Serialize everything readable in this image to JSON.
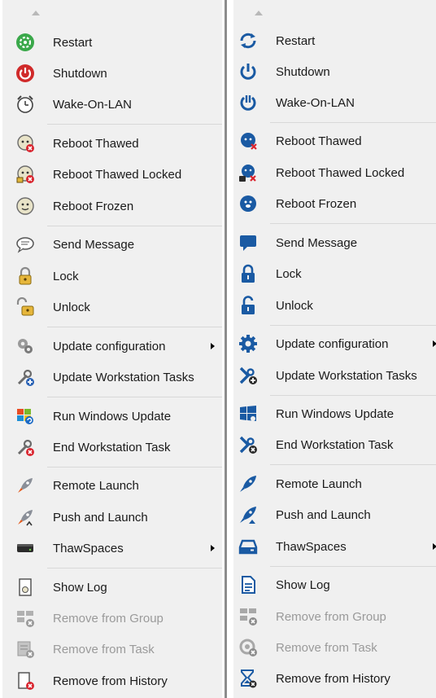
{
  "left_menu": {
    "items": [
      {
        "label": "Restart",
        "icon": "restart-icon"
      },
      {
        "label": "Shutdown",
        "icon": "power-icon"
      },
      {
        "label": "Wake-On-LAN",
        "icon": "alarm-clock-icon"
      },
      {
        "label": "Reboot Thawed",
        "icon": "reboot-thawed-icon"
      },
      {
        "label": "Reboot Thawed Locked",
        "icon": "reboot-thawed-locked-icon"
      },
      {
        "label": "Reboot Frozen",
        "icon": "reboot-frozen-icon"
      },
      {
        "label": "Send Message",
        "icon": "message-icon"
      },
      {
        "label": "Lock",
        "icon": "lock-icon"
      },
      {
        "label": "Unlock",
        "icon": "unlock-icon"
      },
      {
        "label": "Update configuration",
        "icon": "gears-icon",
        "submenu": true
      },
      {
        "label": "Update Workstation Tasks",
        "icon": "tools-add-icon"
      },
      {
        "label": "Run Windows Update",
        "icon": "windows-update-icon"
      },
      {
        "label": "End Workstation Task",
        "icon": "tools-remove-icon"
      },
      {
        "label": "Remote Launch",
        "icon": "rocket-icon"
      },
      {
        "label": "Push and Launch",
        "icon": "rocket-push-icon"
      },
      {
        "label": "ThawSpaces",
        "icon": "drive-icon",
        "submenu": true
      },
      {
        "label": "Show Log",
        "icon": "log-icon"
      },
      {
        "label": "Remove from Group",
        "icon": "remove-group-icon",
        "disabled": true
      },
      {
        "label": "Remove from Task",
        "icon": "remove-task-icon",
        "disabled": true
      },
      {
        "label": "Remove from History",
        "icon": "remove-history-icon"
      }
    ]
  },
  "right_menu": {
    "items": [
      {
        "label": "Restart",
        "icon": "restart-icon"
      },
      {
        "label": "Shutdown",
        "icon": "power-icon"
      },
      {
        "label": "Wake-On-LAN",
        "icon": "wake-power-icon"
      },
      {
        "label": "Reboot Thawed",
        "icon": "reboot-thawed-icon"
      },
      {
        "label": "Reboot Thawed Locked",
        "icon": "reboot-thawed-locked-icon"
      },
      {
        "label": "Reboot Frozen",
        "icon": "reboot-frozen-icon"
      },
      {
        "label": "Send Message",
        "icon": "message-icon"
      },
      {
        "label": "Lock",
        "icon": "lock-icon"
      },
      {
        "label": "Unlock",
        "icon": "unlock-icon"
      },
      {
        "label": "Update configuration",
        "icon": "gear-icon",
        "submenu": true
      },
      {
        "label": "Update Workstation Tasks",
        "icon": "tools-add-icon"
      },
      {
        "label": "Run Windows Update",
        "icon": "windows-update-icon"
      },
      {
        "label": "End Workstation Task",
        "icon": "tools-remove-icon"
      },
      {
        "label": "Remote Launch",
        "icon": "rocket-icon"
      },
      {
        "label": "Push and Launch",
        "icon": "rocket-push-icon"
      },
      {
        "label": "ThawSpaces",
        "icon": "drive-icon",
        "submenu": true
      },
      {
        "label": "Show Log",
        "icon": "log-icon"
      },
      {
        "label": "Remove from Group",
        "icon": "remove-group-icon",
        "disabled": true
      },
      {
        "label": "Remove from Task",
        "icon": "remove-task-icon",
        "disabled": true
      },
      {
        "label": "Remove from History",
        "icon": "hourglass-remove-icon"
      }
    ]
  },
  "colors": {
    "menu_bg": "#f0f0f0",
    "flat_icon": "#1a5aa3",
    "disabled_text": "#9a9a9a",
    "red_badge": "#d9232d"
  }
}
